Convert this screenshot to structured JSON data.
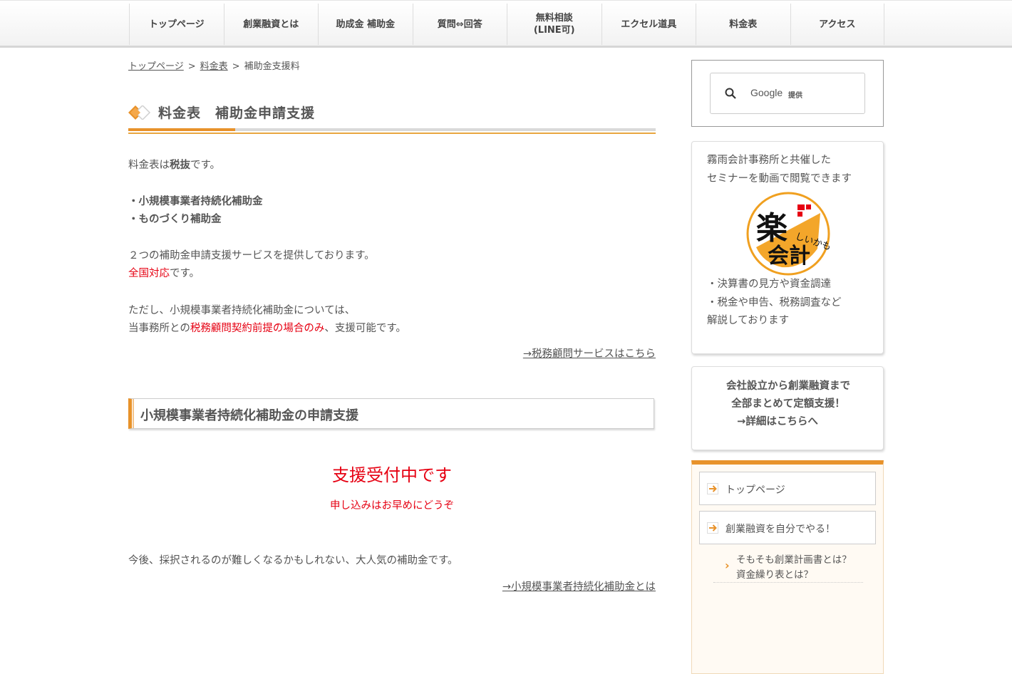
{
  "nav": {
    "items": [
      {
        "label": "トップページ"
      },
      {
        "label": "創業融資とは"
      },
      {
        "label": "助成金 補助金"
      },
      {
        "label": "質問⇔回答"
      },
      {
        "label": "無料相談\n(LINE可)"
      },
      {
        "label": "エクセル道具"
      },
      {
        "label": "料金表"
      },
      {
        "label": "アクセス"
      }
    ]
  },
  "breadcrumb": {
    "home": "トップページ",
    "sep": ">",
    "fees": "料金表",
    "current": "補助金支援料"
  },
  "page_title": "料金表　補助金申請支援",
  "intro": {
    "tax_prefix": "料金表は",
    "tax_bold": "税抜",
    "tax_suffix": "です。",
    "sub1": "・小規模事業者持続化補助金",
    "sub2": "・ものづくり補助金",
    "services": "２つの補助金申請支援サービスを提供しております。",
    "nationwide": "全国対応",
    "nationwide_suffix": "です。",
    "caveat": "ただし、小規模事業者持続化補助金については、",
    "cond_prefix": "当事務所との",
    "cond_red": "税務顧問契約前提の場合のみ",
    "cond_suffix": "、支援可能です。",
    "tax_link": "→税務顧問サービスはこちら"
  },
  "section": {
    "title": "小規模事業者持続化補助金の申請支援",
    "status": "支援受付中です",
    "status_sub": "申し込みはお早めにどうぞ",
    "popular": "今後、採択されるのが難しくなるかもしれない、大人気の補助金です。",
    "about_link": "→小規模事業者持続化補助金とは"
  },
  "sidebar": {
    "search": {
      "brand": "Google",
      "provided": "提供"
    },
    "seminar": {
      "line1": "霧雨会計事務所と共催した",
      "line2": "セミナーを動画で閲覧できます",
      "logo_big": "楽",
      "logo_small": "しいかも",
      "logo_bottom": "会計",
      "bullet1": "・決算書の見方や資金調達",
      "bullet2": "・税金や申告、税務調査など",
      "bullet3": "解説しております"
    },
    "promo": {
      "line1": "会社設立から創業融資まで",
      "line2": "全部まとめて定額支援！",
      "line3": "→詳細はこちらへ"
    },
    "menu": {
      "item1": "トップページ",
      "item2": "創業融資を自分でやる！",
      "sub_line1": "そもそも創業計画書とは？",
      "sub_line2": "資金繰り表とは？"
    }
  },
  "colors": {
    "accent": "#e8922a",
    "red": "#e60012"
  }
}
